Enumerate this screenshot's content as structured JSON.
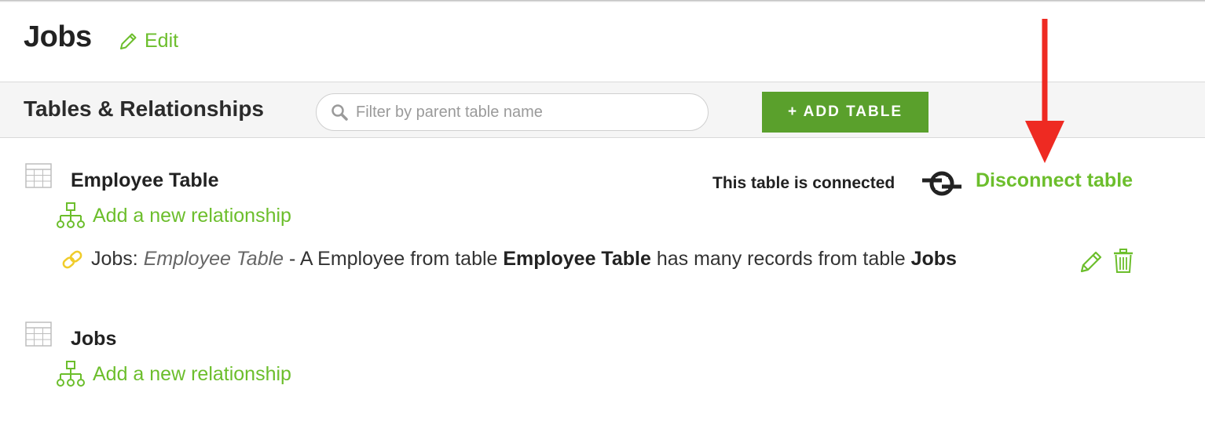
{
  "header": {
    "title": "Jobs",
    "edit_label": "Edit"
  },
  "toolbar": {
    "title": "Tables & Relationships",
    "search_placeholder": "Filter by parent table name",
    "add_table_label": "+ ADD TABLE"
  },
  "tables": [
    {
      "name": "Employee Table",
      "add_relationship_label": "Add a new relationship",
      "connection_status": "This table is connected",
      "disconnect_label": "Disconnect table",
      "relationship": {
        "prefix": "Jobs: ",
        "field": "Employee Table",
        "text1": " - A Employee from table ",
        "parent_table": "Employee Table",
        "text2": " has many records from table ",
        "child_table": "Jobs"
      }
    },
    {
      "name": "Jobs",
      "add_relationship_label": "Add a new relationship"
    }
  ],
  "colors": {
    "accent_green": "#6cbe2c",
    "button_green": "#5aa02c",
    "link_yellow": "#f0cc2a",
    "annotation_red": "#ee2a22"
  },
  "icons": {
    "edit": "pencil-icon",
    "search": "search-icon",
    "table": "grid-icon",
    "relationship": "hierarchy-icon",
    "link": "chain-link-icon",
    "connection": "plug-connection-icon",
    "delete": "trash-icon"
  }
}
